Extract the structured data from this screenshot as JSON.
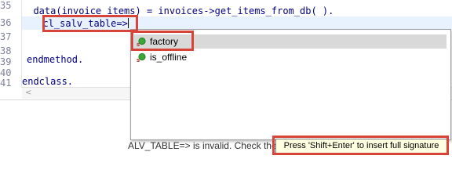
{
  "editor": {
    "line_numbers": [
      "35",
      "36",
      "37",
      "38",
      "39",
      "40",
      "41"
    ],
    "lines": {
      "l35": "  data(invoice_items) = invoices->get_items_from_db( ).",
      "l36": "  cl_salv_table=>",
      "l39": "endmethod.",
      "l41": "endclass."
    },
    "scroll_left_glyph": "<"
  },
  "autocomplete": {
    "items": [
      {
        "label": "factory",
        "icon": "static-method-icon",
        "selected": true
      },
      {
        "label": "is_offline",
        "icon": "static-method-icon",
        "selected": false
      }
    ]
  },
  "status": {
    "partial_message": "ALV_TABLE=> is invalid. Check the spelling. spelling!"
  },
  "tooltip": {
    "text": "Press 'Shift+Enter' to insert full signature"
  },
  "colors": {
    "highlight": "#d9443a",
    "method_icon": "#3aa63a",
    "static_marker": "#c0392b"
  }
}
